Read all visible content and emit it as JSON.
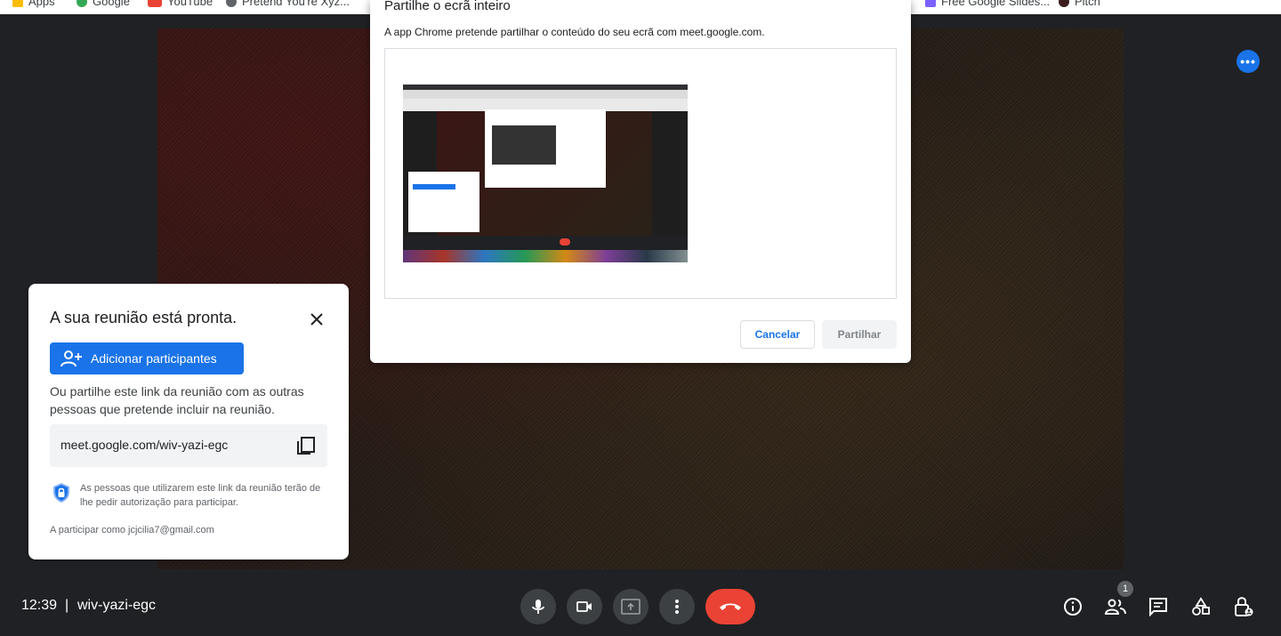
{
  "bookmarks": [
    {
      "label": "Apps",
      "color": "#fbbc04"
    },
    {
      "label": "Google",
      "color": "#34a853"
    },
    {
      "label": "YouTube",
      "color": "#ea4335"
    },
    {
      "label": "Pretend You're Xyz...",
      "color": "#5f6368"
    },
    {
      "label": "Free Google Slides...",
      "color": "#7b61ff"
    },
    {
      "label": "Pitch",
      "color": "#3c1e1e"
    }
  ],
  "share_dialog": {
    "title": "Partilhe o ecrã inteiro",
    "description": "A app Chrome pretende partilhar o conteúdo do seu ecrã com meet.google.com.",
    "cancel_label": "Cancelar",
    "share_label": "Partilhar"
  },
  "ready_panel": {
    "title": "A sua reunião está pronta.",
    "add_button_label": "Adicionar participantes",
    "description": "Ou partilhe este link da reunião com as outras pessoas que pretende incluir na reunião.",
    "meeting_link": "meet.google.com/wiv-yazi-egc",
    "security_note": "As pessoas que utilizarem este link da reunião terão de lhe pedir autorização para participar.",
    "joined_as": "A participar como jcjcilia7@gmail.com"
  },
  "bottom_bar": {
    "time": "12:39",
    "separator": "|",
    "meeting_code": "wiv-yazi-egc",
    "participants_count": "1"
  },
  "colors": {
    "accent": "#1a73e8",
    "end_call": "#ea4335",
    "bar_bg": "#202124",
    "control_bg": "#3c4043"
  }
}
